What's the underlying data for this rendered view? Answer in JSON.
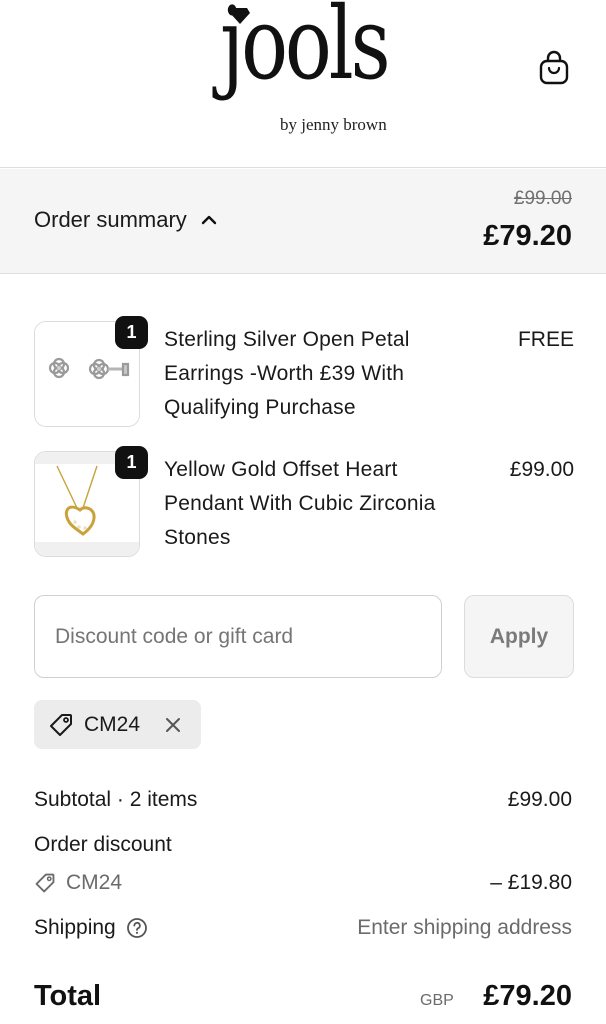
{
  "brand": {
    "name": "jools",
    "tagline": "by jenny brown"
  },
  "summary": {
    "toggle_label": "Order summary",
    "original_price": "£99.00",
    "total_price": "£79.20"
  },
  "items": [
    {
      "quantity": "1",
      "title": "Sterling Silver Open Petal Earrings -Worth £39 With Qualifying Purchase",
      "price": "FREE",
      "image": "silver-earrings"
    },
    {
      "quantity": "1",
      "title": "Yellow Gold Offset Heart Pendant With Cubic Zirconia Stones",
      "price": "£99.00",
      "image": "gold-heart-pendant"
    }
  ],
  "discount": {
    "placeholder": "Discount code or gift card",
    "apply_label": "Apply",
    "applied_code": "CM24"
  },
  "totals": {
    "subtotal_label": "Subtotal · 2 items",
    "subtotal_value": "£99.00",
    "order_discount_label": "Order discount",
    "discount_code": "CM24",
    "discount_value": "– £19.80",
    "shipping_label": "Shipping",
    "shipping_value": "Enter shipping address",
    "total_label": "Total",
    "currency": "GBP",
    "total_value": "£79.20"
  },
  "icons": {
    "bag": "shopping-bag-icon",
    "chevron": "chevron-up-icon",
    "tag": "tag-icon",
    "remove": "close-icon",
    "help": "help-circle-icon"
  },
  "colors": {
    "text": "#1a1a1a",
    "muted": "#6b6b6b",
    "summary_bg": "#f5f5f5",
    "badge": "#111111"
  }
}
